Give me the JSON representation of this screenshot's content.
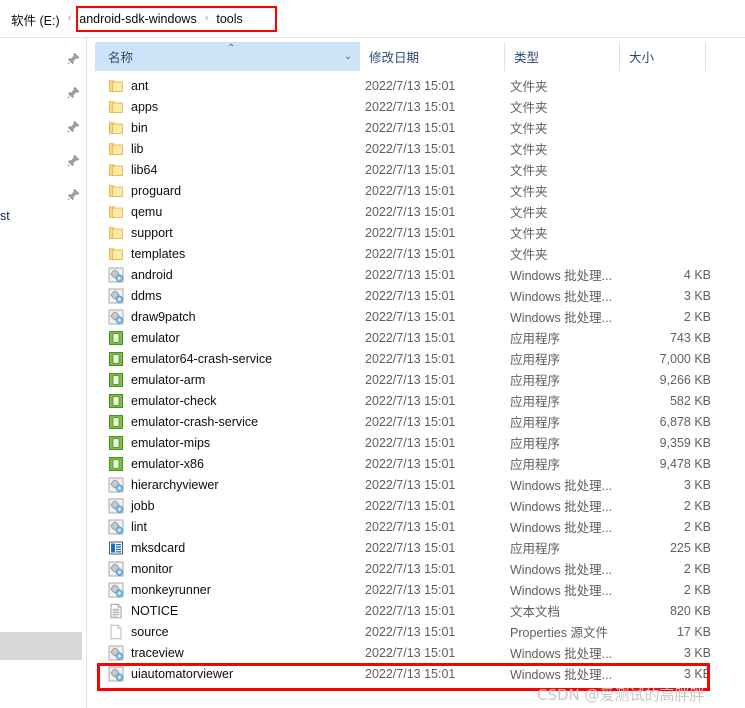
{
  "addressbar": {
    "crumbs": [
      {
        "label": "软件 (E:)",
        "sep": "›"
      },
      {
        "label": "android-sdk-windows",
        "sep": "›"
      },
      {
        "label": "tools",
        "sep": ""
      }
    ],
    "highlight_color": "#fe0000"
  },
  "navpane": {
    "pin_icon_name": "pushpin-icon",
    "pin_count": 5,
    "partial_text": "st"
  },
  "columns": {
    "name": "名称",
    "date": "修改日期",
    "type": "类型",
    "size": "大小",
    "sort_caret": "⌃",
    "chevron": "⌄",
    "header_bg": "#cee3f8"
  },
  "files": [
    {
      "name": "ant",
      "date": "2022/7/13 15:01",
      "type": "文件夹",
      "size": "",
      "icon": "folder-icon"
    },
    {
      "name": "apps",
      "date": "2022/7/13 15:01",
      "type": "文件夹",
      "size": "",
      "icon": "folder-icon"
    },
    {
      "name": "bin",
      "date": "2022/7/13 15:01",
      "type": "文件夹",
      "size": "",
      "icon": "folder-icon"
    },
    {
      "name": "lib",
      "date": "2022/7/13 15:01",
      "type": "文件夹",
      "size": "",
      "icon": "folder-icon"
    },
    {
      "name": "lib64",
      "date": "2022/7/13 15:01",
      "type": "文件夹",
      "size": "",
      "icon": "folder-icon"
    },
    {
      "name": "proguard",
      "date": "2022/7/13 15:01",
      "type": "文件夹",
      "size": "",
      "icon": "folder-icon"
    },
    {
      "name": "qemu",
      "date": "2022/7/13 15:01",
      "type": "文件夹",
      "size": "",
      "icon": "folder-icon"
    },
    {
      "name": "support",
      "date": "2022/7/13 15:01",
      "type": "文件夹",
      "size": "",
      "icon": "folder-icon"
    },
    {
      "name": "templates",
      "date": "2022/7/13 15:01",
      "type": "文件夹",
      "size": "",
      "icon": "folder-icon"
    },
    {
      "name": "android",
      "date": "2022/7/13 15:01",
      "type": "Windows 批处理...",
      "size": "4 KB",
      "icon": "batch-file-icon"
    },
    {
      "name": "ddms",
      "date": "2022/7/13 15:01",
      "type": "Windows 批处理...",
      "size": "3 KB",
      "icon": "batch-file-icon"
    },
    {
      "name": "draw9patch",
      "date": "2022/7/13 15:01",
      "type": "Windows 批处理...",
      "size": "2 KB",
      "icon": "batch-file-icon"
    },
    {
      "name": "emulator",
      "date": "2022/7/13 15:01",
      "type": "应用程序",
      "size": "743 KB",
      "icon": "android-app-icon"
    },
    {
      "name": "emulator64-crash-service",
      "date": "2022/7/13 15:01",
      "type": "应用程序",
      "size": "7,000 KB",
      "icon": "android-app-icon"
    },
    {
      "name": "emulator-arm",
      "date": "2022/7/13 15:01",
      "type": "应用程序",
      "size": "9,266 KB",
      "icon": "android-app-icon"
    },
    {
      "name": "emulator-check",
      "date": "2022/7/13 15:01",
      "type": "应用程序",
      "size": "582 KB",
      "icon": "android-app-icon"
    },
    {
      "name": "emulator-crash-service",
      "date": "2022/7/13 15:01",
      "type": "应用程序",
      "size": "6,878 KB",
      "icon": "android-app-icon"
    },
    {
      "name": "emulator-mips",
      "date": "2022/7/13 15:01",
      "type": "应用程序",
      "size": "9,359 KB",
      "icon": "android-app-icon"
    },
    {
      "name": "emulator-x86",
      "date": "2022/7/13 15:01",
      "type": "应用程序",
      "size": "9,478 KB",
      "icon": "android-app-icon"
    },
    {
      "name": "hierarchyviewer",
      "date": "2022/7/13 15:01",
      "type": "Windows 批处理...",
      "size": "3 KB",
      "icon": "batch-file-icon"
    },
    {
      "name": "jobb",
      "date": "2022/7/13 15:01",
      "type": "Windows 批处理...",
      "size": "2 KB",
      "icon": "batch-file-icon"
    },
    {
      "name": "lint",
      "date": "2022/7/13 15:01",
      "type": "Windows 批处理...",
      "size": "2 KB",
      "icon": "batch-file-icon"
    },
    {
      "name": "mksdcard",
      "date": "2022/7/13 15:01",
      "type": "应用程序",
      "size": "225 KB",
      "icon": "exe-app-icon"
    },
    {
      "name": "monitor",
      "date": "2022/7/13 15:01",
      "type": "Windows 批处理...",
      "size": "2 KB",
      "icon": "batch-file-icon"
    },
    {
      "name": "monkeyrunner",
      "date": "2022/7/13 15:01",
      "type": "Windows 批处理...",
      "size": "2 KB",
      "icon": "batch-file-icon"
    },
    {
      "name": "NOTICE",
      "date": "2022/7/13 15:01",
      "type": "文本文档",
      "size": "820 KB",
      "icon": "text-document-icon"
    },
    {
      "name": "source",
      "date": "2022/7/13 15:01",
      "type": "Properties 源文件",
      "size": "17 KB",
      "icon": "properties-file-icon"
    },
    {
      "name": "traceview",
      "date": "2022/7/13 15:01",
      "type": "Windows 批处理...",
      "size": "3 KB",
      "icon": "batch-file-icon"
    },
    {
      "name": "uiautomatorviewer",
      "date": "2022/7/13 15:01",
      "type": "Windows 批处理...",
      "size": "3 KB",
      "icon": "batch-file-icon"
    }
  ],
  "highlighted_file": "uiautomatorviewer",
  "watermark": {
    "text": "CSDN @爱测试的高胖胖"
  }
}
